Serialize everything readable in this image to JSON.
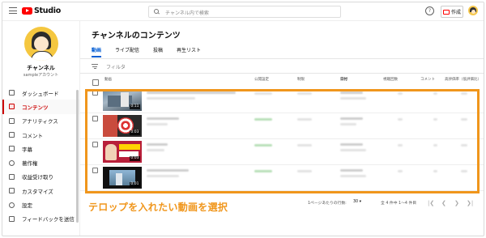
{
  "app": {
    "logo_text": "Studio"
  },
  "search": {
    "placeholder": "チャンネル内で検索"
  },
  "topbar": {
    "help_label": "?",
    "create_label": "作成"
  },
  "channel": {
    "name": "チャンネル",
    "subtitle": "sampleアカウント"
  },
  "sidebar": {
    "items": [
      {
        "label": "ダッシュボード",
        "icon": "dashboard-icon"
      },
      {
        "label": "コンテンツ",
        "icon": "content-icon",
        "active": true
      },
      {
        "label": "アナリティクス",
        "icon": "analytics-icon"
      },
      {
        "label": "コメント",
        "icon": "comment-icon"
      },
      {
        "label": "字幕",
        "icon": "subtitles-icon"
      },
      {
        "label": "著作権",
        "icon": "copyright-icon"
      },
      {
        "label": "収益受け取り",
        "icon": "monetization-icon"
      },
      {
        "label": "カスタマイズ",
        "icon": "customize-icon"
      },
      {
        "label": "設定",
        "icon": "settings-icon"
      },
      {
        "label": "フィードバックを送信",
        "icon": "feedback-icon"
      }
    ]
  },
  "main": {
    "title": "チャンネルのコンテンツ",
    "tabs": [
      {
        "label": "動画",
        "active": true
      },
      {
        "label": "ライブ配信"
      },
      {
        "label": "投稿"
      },
      {
        "label": "再生リスト"
      }
    ],
    "filter_label": "フィルタ",
    "columns": [
      "動画",
      "公開設定",
      "制限",
      "日付",
      "視聴回数",
      "コメント",
      "高評価率（低評価比）"
    ],
    "rows": [
      {
        "duration": "0:11"
      },
      {
        "duration": "0:03"
      },
      {
        "duration": "0:03"
      },
      {
        "duration": "0:01"
      }
    ],
    "pagination": {
      "rows_per_page_label": "1ページあたりの行数:",
      "rows_per_page": "30",
      "range": "全 4 件中 1〜4 件目"
    }
  },
  "annotation": {
    "caption": "テロップを入れたい動画を選択",
    "color": "#f0961c"
  }
}
